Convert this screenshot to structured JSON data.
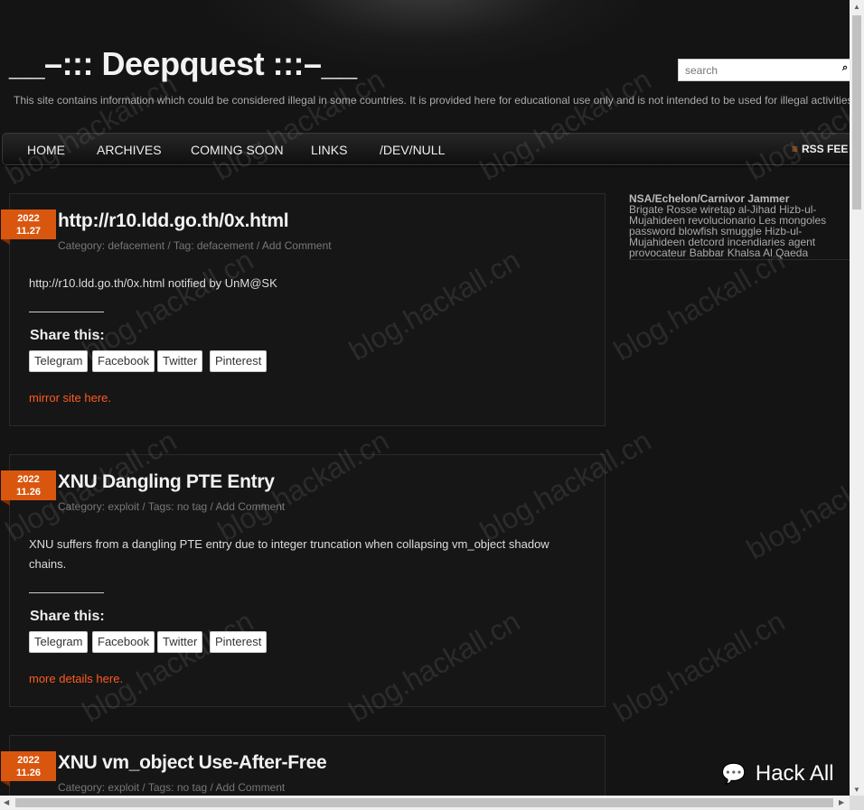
{
  "site": {
    "title": "__–::: Deepquest :::–__",
    "disclaimer": "This site contains information which could be considered illegal in some countries. It is provided here for educational use only and is not intended to be used for illegal activities"
  },
  "search": {
    "placeholder": "search",
    "button_icon": "search-icon"
  },
  "nav": {
    "items": [
      "HOME",
      "ARCHIVES",
      "COMING SOON",
      "LINKS",
      "/DEV/NULL"
    ],
    "rss_label": "RSS FEE"
  },
  "posts": [
    {
      "date_year": "2022",
      "date_md": "11.27",
      "title": "http://r10.ldd.go.th/0x.html",
      "meta": "Category: defacement / Tag: defacement / Add Comment",
      "body": "http://r10.ldd.go.th/0x.html notified by UnM@SK",
      "share_title": "Share this:",
      "share_buttons": [
        "Telegram",
        "Facebook",
        "Twitter",
        "Pinterest"
      ],
      "link_text": "mirror site here."
    },
    {
      "date_year": "2022",
      "date_md": "11.26",
      "title": "XNU Dangling PTE Entry",
      "meta": "Category: exploit / Tags: no tag / Add Comment",
      "body": "XNU suffers from a dangling PTE entry due to integer truncation when collapsing vm_object shadow chains.",
      "share_title": "Share this:",
      "share_buttons": [
        "Telegram",
        "Facebook",
        "Twitter",
        "Pinterest"
      ],
      "link_text": "more details here."
    },
    {
      "date_year": "2022",
      "date_md": "11.26",
      "title": "XNU vm_object Use-After-Free",
      "meta": "Category: exploit / Tags: no tag / Add Comment"
    }
  ],
  "sidebar": {
    "title": "NSA/Echelon/Carnivor Jammer",
    "text": "Brigate Rosse wiretap al-Jihad Hizb-ul-Mujahideen revolucionario Les mongoles password blowfish smuggle Hizb-ul-Mujahideen detcord incendiaries agent provocateur Babbar Khalsa Al Qaeda"
  },
  "watermark": "blog.hackall.cn",
  "badge": {
    "text": "Hack All",
    "icon": "wechat-icon"
  },
  "colors": {
    "accent": "#d9560f",
    "link": "#ff5b1f",
    "background": "#141414"
  }
}
